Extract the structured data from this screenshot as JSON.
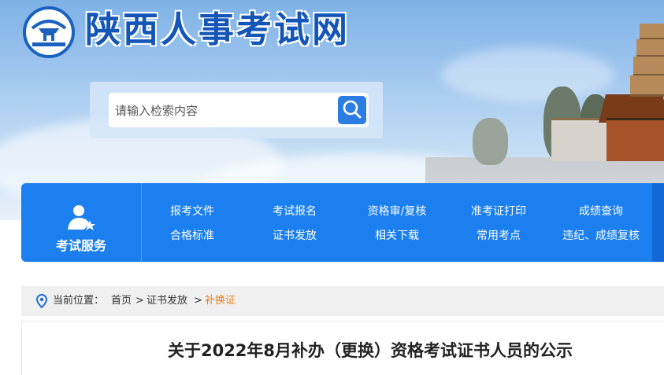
{
  "site": {
    "title": "陕西人事考试网"
  },
  "search": {
    "placeholder": "请输入检索内容"
  },
  "nav": {
    "service_label": "考试服务",
    "items": [
      "报考文件",
      "考试报名",
      "资格审/复核",
      "准考证打印",
      "成绩查询",
      "合格标准",
      "证书发放",
      "相关下载",
      "常用考点",
      "违纪、成绩复核"
    ]
  },
  "breadcrumb": {
    "label": "当前位置：",
    "items": [
      "首页",
      "证书发放",
      "补换证"
    ],
    "separator": ">"
  },
  "article": {
    "title": "关于2022年8月补办（更换）资格考试证书人员的公示"
  },
  "colors": {
    "brand": "#1b7ff0",
    "logo_text": "#1455b8",
    "breadcrumb_current": "#e87f1d"
  }
}
